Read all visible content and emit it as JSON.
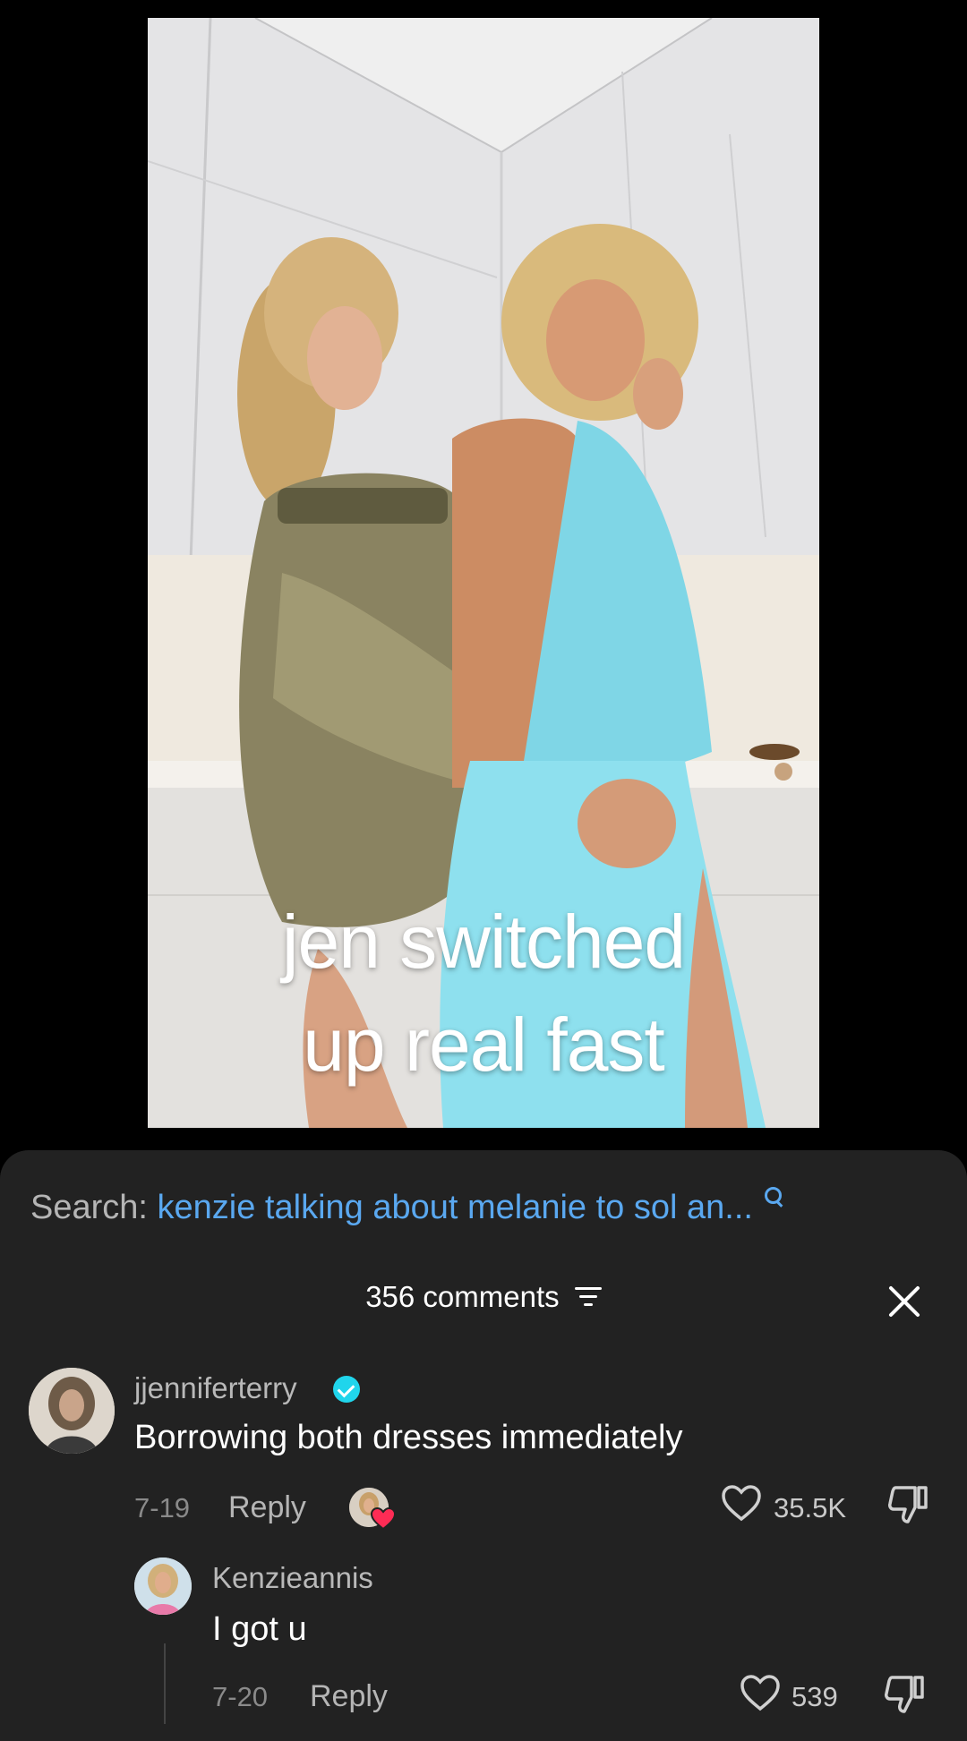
{
  "video": {
    "caption_line1": "jen switched",
    "caption_line2": "up real fast"
  },
  "search": {
    "label": "Search:",
    "query": "kenzie talking about melanie to sol an..."
  },
  "comments_header": {
    "count_label": "356 comments"
  },
  "comments": [
    {
      "username": "jjenniferterry",
      "verified": true,
      "text": "Borrowing both dresses immediately",
      "date": "7-19",
      "reply_label": "Reply",
      "likes": "35.5K",
      "creator_liked": true
    },
    {
      "username": "Kenzieannis",
      "text": "I got u",
      "date": "7-20",
      "reply_label": "Reply",
      "likes": "539"
    }
  ],
  "colors": {
    "background": "#000000",
    "sheet": "#222222",
    "link": "#5aa8f0",
    "verified": "#20d5ec",
    "heart_badge": "#fe2c55"
  },
  "icons": [
    "search-icon",
    "filter-icon",
    "close-icon",
    "verified-icon",
    "heart-icon",
    "dislike-icon"
  ]
}
